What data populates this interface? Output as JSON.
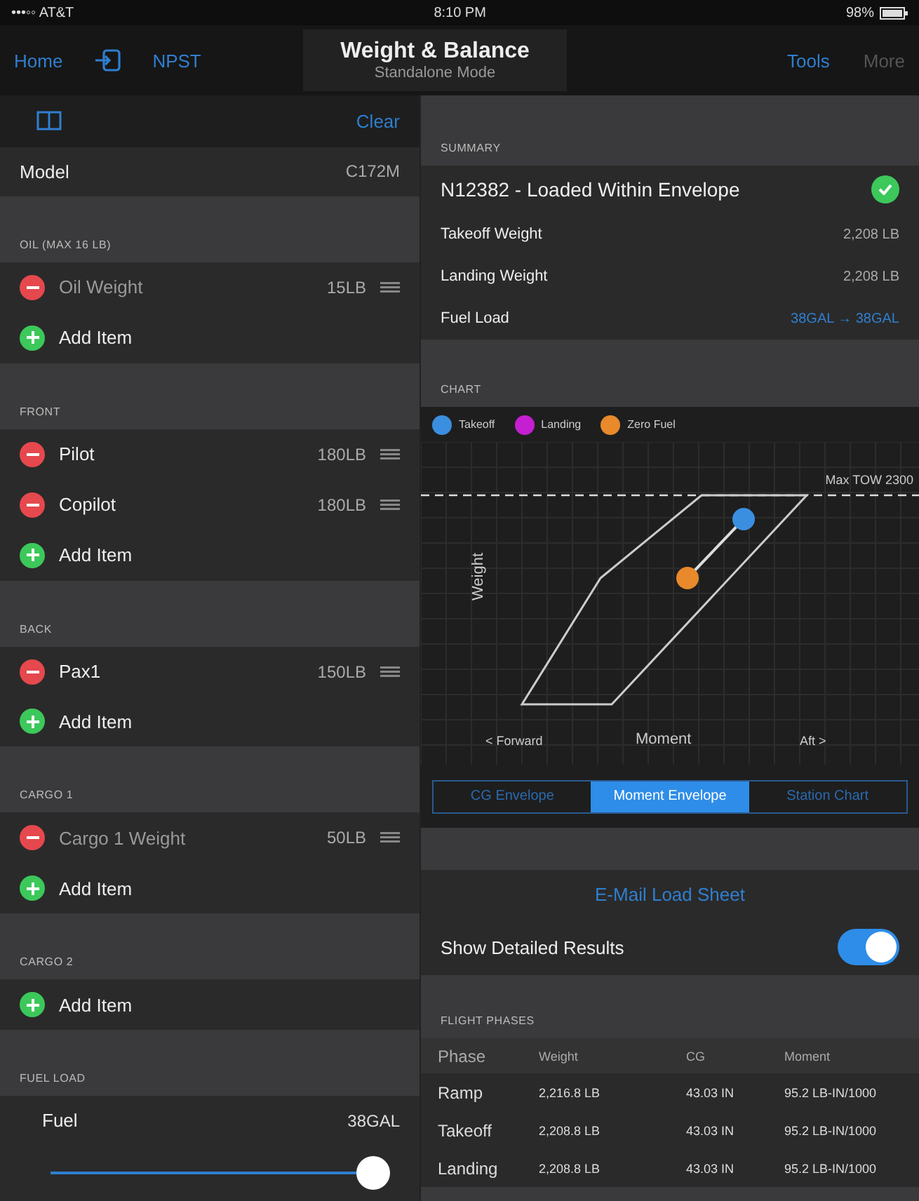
{
  "status_bar": {
    "carrier": "•••◦◦ AT&T",
    "time": "8:10 PM",
    "battery": "98%"
  },
  "nav": {
    "left": [
      {
        "kind": "text",
        "label": "Home"
      },
      {
        "kind": "icon"
      },
      {
        "kind": "text",
        "label": "NPST"
      }
    ],
    "title": "Weight & Balance",
    "subtitle": "Standalone Mode",
    "right": [
      {
        "label": "Tools",
        "disabled": false
      },
      {
        "label": "More",
        "disabled": true
      }
    ]
  },
  "left": {
    "clear": "Clear",
    "model": {
      "label": "Model",
      "value": "C172M"
    },
    "sections": [
      {
        "title": "OIL (MAX 16 LB)",
        "rows": [
          {
            "kind": "item",
            "name": "Oil Weight",
            "value": "15LB",
            "dimmed": true
          },
          {
            "kind": "add",
            "name": "Add Item"
          }
        ]
      },
      {
        "title": "FRONT",
        "rows": [
          {
            "kind": "item",
            "name": "Pilot",
            "value": "180LB",
            "dimmed": false
          },
          {
            "kind": "item",
            "name": "Copilot",
            "value": "180LB",
            "dimmed": false
          },
          {
            "kind": "add",
            "name": "Add Item"
          }
        ]
      },
      {
        "title": "BACK",
        "rows": [
          {
            "kind": "item",
            "name": "Pax1",
            "value": "150LB",
            "dimmed": false
          },
          {
            "kind": "add",
            "name": "Add Item"
          }
        ]
      },
      {
        "title": "CARGO 1",
        "rows": [
          {
            "kind": "item",
            "name": "Cargo 1 Weight",
            "value": "50LB",
            "dimmed": true
          },
          {
            "kind": "add",
            "name": "Add Item"
          }
        ]
      },
      {
        "title": "CARGO 2",
        "rows": [
          {
            "kind": "add",
            "name": "Add Item"
          }
        ]
      }
    ],
    "fuel": {
      "title": "FUEL LOAD",
      "label": "Fuel",
      "value": "38GAL",
      "level": 0.97
    }
  },
  "right": {
    "summary": {
      "title": "SUMMARY",
      "headline": "N12382 - Loaded Within Envelope",
      "ok": true,
      "rows": [
        {
          "label": "Takeoff Weight",
          "value": "2,208 LB",
          "link": false
        },
        {
          "label": "Landing Weight",
          "value": "2,208 LB",
          "link": false
        },
        {
          "label": "Fuel Load",
          "value": "38GAL → 38GAL",
          "link": true
        }
      ]
    },
    "chart": {
      "title": "CHART",
      "legend": [
        {
          "label": "Takeoff",
          "color": "#3b8fe0"
        },
        {
          "label": "Landing",
          "color": "#c41fd0"
        },
        {
          "label": "Zero Fuel",
          "color": "#e8892b"
        }
      ],
      "max_label": "Max TOW 2300",
      "ylabel": "Weight",
      "xlabel": "Moment",
      "forward": "< Forward",
      "aft": "Aft >",
      "tabs": [
        {
          "label": "CG Envelope",
          "selected": false
        },
        {
          "label": "Moment Envelope",
          "selected": true
        },
        {
          "label": "Station Chart",
          "selected": false
        }
      ]
    },
    "email": "E-Mail Load Sheet",
    "detailed": {
      "label": "Show Detailed Results",
      "on": true
    },
    "phases": {
      "title": "FLIGHT PHASES",
      "columns": [
        "Phase",
        "Weight",
        "CG",
        "Moment"
      ],
      "rows": [
        [
          "Ramp",
          "2,216.8 LB",
          "43.03 IN",
          "95.2 LB-IN/1000"
        ],
        [
          "Takeoff",
          "2,208.8 LB",
          "43.03 IN",
          "95.2 LB-IN/1000"
        ],
        [
          "Landing",
          "2,208.8 LB",
          "43.03 IN",
          "95.2 LB-IN/1000"
        ]
      ]
    }
  }
}
